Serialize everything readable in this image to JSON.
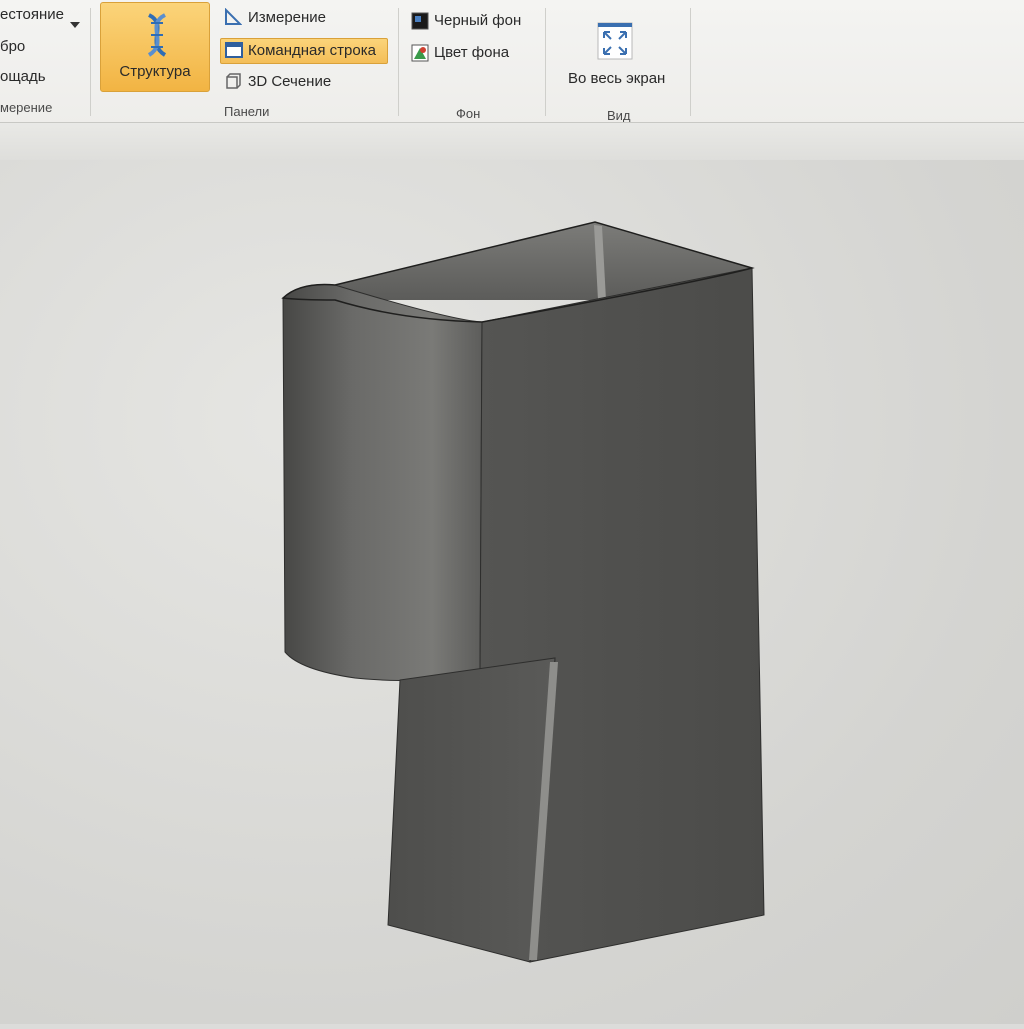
{
  "ribbon": {
    "left_group": {
      "items": [
        "естояние",
        "бро",
        "ощадь"
      ],
      "group_label": "мерение"
    },
    "structure_label": "Структура",
    "panels": {
      "items": [
        "Измерение",
        "Командная строка",
        "3D Сечение"
      ],
      "group_label": "Панели"
    },
    "background": {
      "items": [
        "Черный фон",
        "Цвет фона"
      ],
      "group_label": "Фон"
    },
    "view": {
      "fullscreen_label": "Во весь экран",
      "group_label": "Вид"
    }
  },
  "icons": {
    "structure": "dna-icon",
    "measure": "ruler-angle-icon",
    "command_line": "console-window-icon",
    "section": "section-box-icon",
    "black_bg": "black-square-icon",
    "bg_color": "palette-icon",
    "fullscreen": "expand-arrows-icon",
    "dropdown": "chevron-down-icon"
  },
  "colors": {
    "highlight": "#f4be58",
    "model": "#5a5a58",
    "viewport": "#dcdcda"
  }
}
